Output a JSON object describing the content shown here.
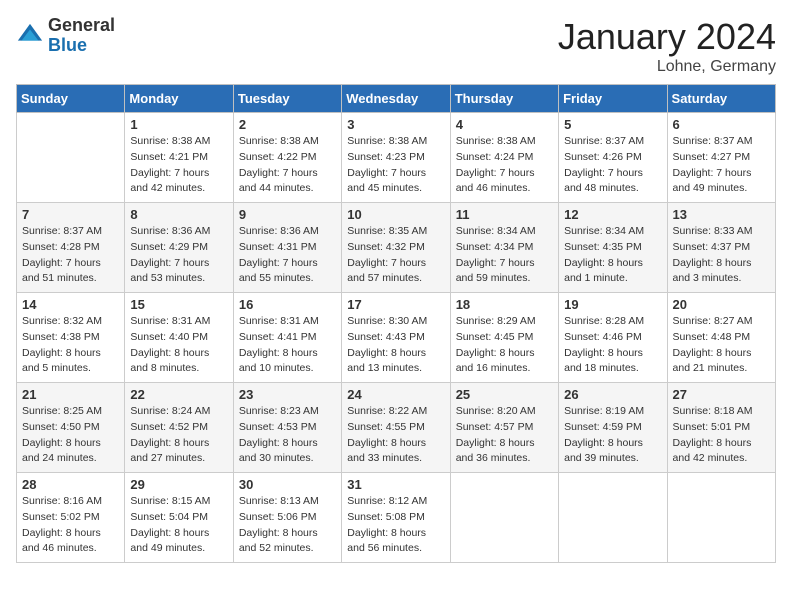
{
  "header": {
    "logo_general": "General",
    "logo_blue": "Blue",
    "month_title": "January 2024",
    "location": "Lohne, Germany"
  },
  "columns": [
    "Sunday",
    "Monday",
    "Tuesday",
    "Wednesday",
    "Thursday",
    "Friday",
    "Saturday"
  ],
  "weeks": [
    [
      {
        "day": "",
        "sunrise": "",
        "sunset": "",
        "daylight": ""
      },
      {
        "day": "1",
        "sunrise": "Sunrise: 8:38 AM",
        "sunset": "Sunset: 4:21 PM",
        "daylight": "Daylight: 7 hours and 42 minutes."
      },
      {
        "day": "2",
        "sunrise": "Sunrise: 8:38 AM",
        "sunset": "Sunset: 4:22 PM",
        "daylight": "Daylight: 7 hours and 44 minutes."
      },
      {
        "day": "3",
        "sunrise": "Sunrise: 8:38 AM",
        "sunset": "Sunset: 4:23 PM",
        "daylight": "Daylight: 7 hours and 45 minutes."
      },
      {
        "day": "4",
        "sunrise": "Sunrise: 8:38 AM",
        "sunset": "Sunset: 4:24 PM",
        "daylight": "Daylight: 7 hours and 46 minutes."
      },
      {
        "day": "5",
        "sunrise": "Sunrise: 8:37 AM",
        "sunset": "Sunset: 4:26 PM",
        "daylight": "Daylight: 7 hours and 48 minutes."
      },
      {
        "day": "6",
        "sunrise": "Sunrise: 8:37 AM",
        "sunset": "Sunset: 4:27 PM",
        "daylight": "Daylight: 7 hours and 49 minutes."
      }
    ],
    [
      {
        "day": "7",
        "sunrise": "Sunrise: 8:37 AM",
        "sunset": "Sunset: 4:28 PM",
        "daylight": "Daylight: 7 hours and 51 minutes."
      },
      {
        "day": "8",
        "sunrise": "Sunrise: 8:36 AM",
        "sunset": "Sunset: 4:29 PM",
        "daylight": "Daylight: 7 hours and 53 minutes."
      },
      {
        "day": "9",
        "sunrise": "Sunrise: 8:36 AM",
        "sunset": "Sunset: 4:31 PM",
        "daylight": "Daylight: 7 hours and 55 minutes."
      },
      {
        "day": "10",
        "sunrise": "Sunrise: 8:35 AM",
        "sunset": "Sunset: 4:32 PM",
        "daylight": "Daylight: 7 hours and 57 minutes."
      },
      {
        "day": "11",
        "sunrise": "Sunrise: 8:34 AM",
        "sunset": "Sunset: 4:34 PM",
        "daylight": "Daylight: 7 hours and 59 minutes."
      },
      {
        "day": "12",
        "sunrise": "Sunrise: 8:34 AM",
        "sunset": "Sunset: 4:35 PM",
        "daylight": "Daylight: 8 hours and 1 minute."
      },
      {
        "day": "13",
        "sunrise": "Sunrise: 8:33 AM",
        "sunset": "Sunset: 4:37 PM",
        "daylight": "Daylight: 8 hours and 3 minutes."
      }
    ],
    [
      {
        "day": "14",
        "sunrise": "Sunrise: 8:32 AM",
        "sunset": "Sunset: 4:38 PM",
        "daylight": "Daylight: 8 hours and 5 minutes."
      },
      {
        "day": "15",
        "sunrise": "Sunrise: 8:31 AM",
        "sunset": "Sunset: 4:40 PM",
        "daylight": "Daylight: 8 hours and 8 minutes."
      },
      {
        "day": "16",
        "sunrise": "Sunrise: 8:31 AM",
        "sunset": "Sunset: 4:41 PM",
        "daylight": "Daylight: 8 hours and 10 minutes."
      },
      {
        "day": "17",
        "sunrise": "Sunrise: 8:30 AM",
        "sunset": "Sunset: 4:43 PM",
        "daylight": "Daylight: 8 hours and 13 minutes."
      },
      {
        "day": "18",
        "sunrise": "Sunrise: 8:29 AM",
        "sunset": "Sunset: 4:45 PM",
        "daylight": "Daylight: 8 hours and 16 minutes."
      },
      {
        "day": "19",
        "sunrise": "Sunrise: 8:28 AM",
        "sunset": "Sunset: 4:46 PM",
        "daylight": "Daylight: 8 hours and 18 minutes."
      },
      {
        "day": "20",
        "sunrise": "Sunrise: 8:27 AM",
        "sunset": "Sunset: 4:48 PM",
        "daylight": "Daylight: 8 hours and 21 minutes."
      }
    ],
    [
      {
        "day": "21",
        "sunrise": "Sunrise: 8:25 AM",
        "sunset": "Sunset: 4:50 PM",
        "daylight": "Daylight: 8 hours and 24 minutes."
      },
      {
        "day": "22",
        "sunrise": "Sunrise: 8:24 AM",
        "sunset": "Sunset: 4:52 PM",
        "daylight": "Daylight: 8 hours and 27 minutes."
      },
      {
        "day": "23",
        "sunrise": "Sunrise: 8:23 AM",
        "sunset": "Sunset: 4:53 PM",
        "daylight": "Daylight: 8 hours and 30 minutes."
      },
      {
        "day": "24",
        "sunrise": "Sunrise: 8:22 AM",
        "sunset": "Sunset: 4:55 PM",
        "daylight": "Daylight: 8 hours and 33 minutes."
      },
      {
        "day": "25",
        "sunrise": "Sunrise: 8:20 AM",
        "sunset": "Sunset: 4:57 PM",
        "daylight": "Daylight: 8 hours and 36 minutes."
      },
      {
        "day": "26",
        "sunrise": "Sunrise: 8:19 AM",
        "sunset": "Sunset: 4:59 PM",
        "daylight": "Daylight: 8 hours and 39 minutes."
      },
      {
        "day": "27",
        "sunrise": "Sunrise: 8:18 AM",
        "sunset": "Sunset: 5:01 PM",
        "daylight": "Daylight: 8 hours and 42 minutes."
      }
    ],
    [
      {
        "day": "28",
        "sunrise": "Sunrise: 8:16 AM",
        "sunset": "Sunset: 5:02 PM",
        "daylight": "Daylight: 8 hours and 46 minutes."
      },
      {
        "day": "29",
        "sunrise": "Sunrise: 8:15 AM",
        "sunset": "Sunset: 5:04 PM",
        "daylight": "Daylight: 8 hours and 49 minutes."
      },
      {
        "day": "30",
        "sunrise": "Sunrise: 8:13 AM",
        "sunset": "Sunset: 5:06 PM",
        "daylight": "Daylight: 8 hours and 52 minutes."
      },
      {
        "day": "31",
        "sunrise": "Sunrise: 8:12 AM",
        "sunset": "Sunset: 5:08 PM",
        "daylight": "Daylight: 8 hours and 56 minutes."
      },
      {
        "day": "",
        "sunrise": "",
        "sunset": "",
        "daylight": ""
      },
      {
        "day": "",
        "sunrise": "",
        "sunset": "",
        "daylight": ""
      },
      {
        "day": "",
        "sunrise": "",
        "sunset": "",
        "daylight": ""
      }
    ]
  ]
}
